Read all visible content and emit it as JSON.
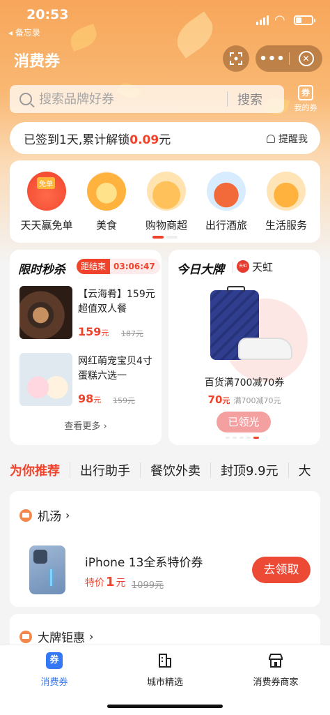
{
  "status_bar": {
    "time": "20:53",
    "back_label": "◂ 备忘录"
  },
  "nav": {
    "title": "消费券",
    "more_label": "•••",
    "close_label": "✕"
  },
  "search": {
    "placeholder": "搜索品牌好券",
    "button_label": "搜索",
    "my_coupon_label": "我的券",
    "my_coupon_icon": "券"
  },
  "sign_in": {
    "text_prefix": "已签到1天,累计解锁",
    "amount": "0.09",
    "unit": "元",
    "remind_label": "提醒我"
  },
  "categories": [
    {
      "label": "天天赢免单",
      "icon": "free-order-icon",
      "badge": "免单"
    },
    {
      "label": "美食",
      "icon": "food-bowl-icon"
    },
    {
      "label": "购物商超",
      "icon": "shopping-basket-icon"
    },
    {
      "label": "出行酒旅",
      "icon": "car-icon"
    },
    {
      "label": "生活服务",
      "icon": "house-icon"
    }
  ],
  "flash_sale": {
    "title": "限时秒杀",
    "countdown_label": "距结束",
    "countdown_time": "03:06:47",
    "items": [
      {
        "name": "【云海肴】159元超值双人餐",
        "price": "159",
        "price_unit": "元",
        "original_price": "187元"
      },
      {
        "name": "网红萌宠宝贝4寸蛋糕六选一",
        "price": "98",
        "price_unit": "元",
        "original_price": "159元"
      }
    ],
    "see_more": "查看更多 ›"
  },
  "big_brand": {
    "title": "今日大牌",
    "brand_logo_text": "天虹",
    "brand_name": "天虹",
    "desc": "百货满700减70券",
    "price": "70",
    "price_unit": "元",
    "condition": "满700减70元",
    "button_label": "已领光"
  },
  "tabs": [
    "为你推荐",
    "出行助手",
    "餐饮外卖",
    "封顶9.9元",
    "大"
  ],
  "sections": [
    {
      "title": "机汤",
      "product": {
        "name": "iPhone 13全系特价券",
        "price_prefix": "特价",
        "price": "1",
        "price_unit": "元",
        "original_price": "1099元",
        "button_label": "去领取"
      }
    },
    {
      "title": "大牌钜惠"
    }
  ],
  "bottom_nav": [
    {
      "label": "消费券",
      "icon": "coupon-icon",
      "icon_text": "券",
      "active": true
    },
    {
      "label": "城市精选",
      "icon": "city-building-icon"
    },
    {
      "label": "消费券商家",
      "icon": "store-icon"
    }
  ],
  "colors": {
    "accent": "#f0432c",
    "active_tab": "#3478f6",
    "header": "#f7a65a"
  }
}
